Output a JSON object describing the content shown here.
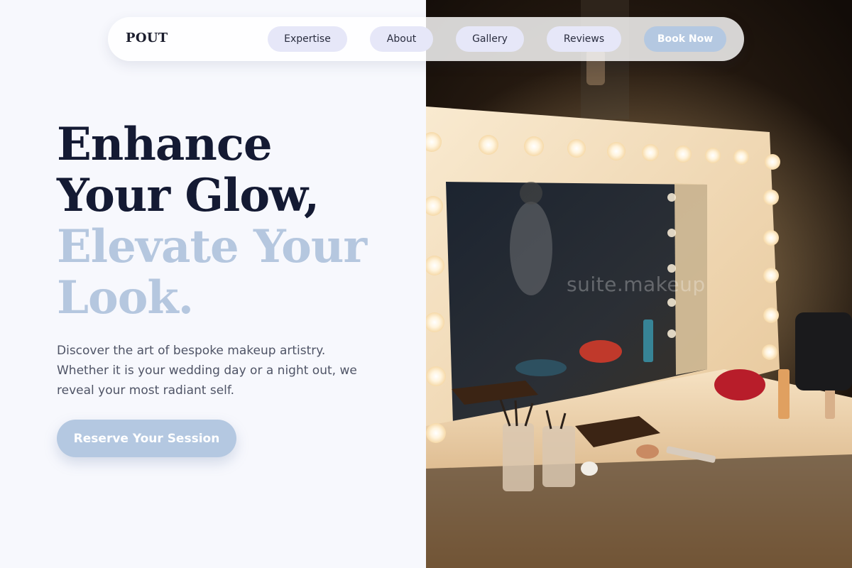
{
  "brand": {
    "name": "POUT"
  },
  "nav": {
    "items": [
      {
        "label": "Expertise"
      },
      {
        "label": "About"
      },
      {
        "label": "Gallery"
      },
      {
        "label": "Reviews"
      }
    ],
    "book_label": "Book Now"
  },
  "hero": {
    "title_dark_line1": "Enhance",
    "title_dark_line2": "Your Glow,",
    "title_accent_line1": "Elevate Your",
    "title_accent_line2": "Look.",
    "description": "Discover the art of bespoke makeup artistry. Whether it is your wedding day or a night out, we reveal your most radiant self.",
    "cta_label": "Reserve Your Session"
  },
  "photo": {
    "watermark": "suite.makeup"
  },
  "colors": {
    "accent": "#b4c8e1",
    "heading": "#141a33",
    "background": "#f7f8fd",
    "pill": "#e6e7f8"
  }
}
